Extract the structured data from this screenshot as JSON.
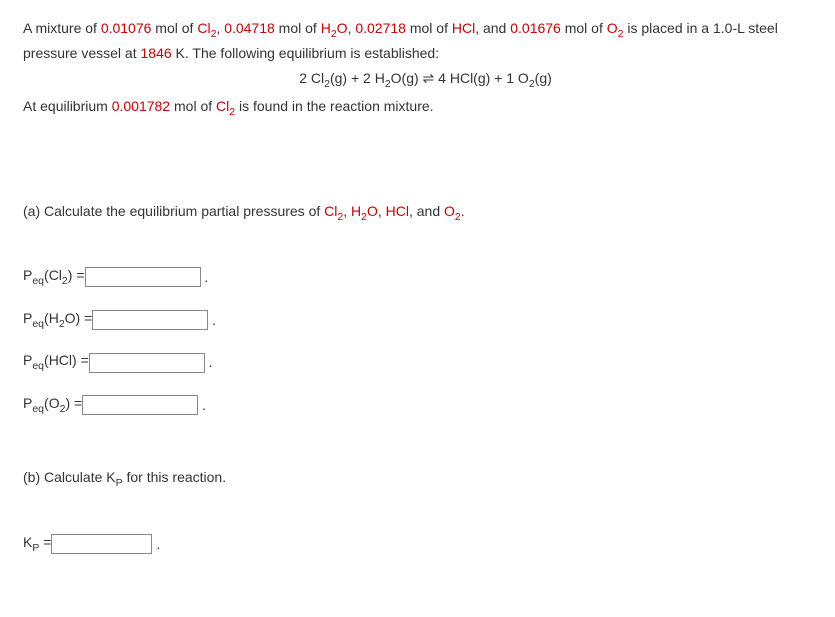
{
  "problem": {
    "intro1": "A mixture of ",
    "val1": "0.01076",
    "unit1": " mol of ",
    "sp1": "Cl",
    "sp1sub": "2",
    "sep1": ", ",
    "val2": "0.04718",
    "unit2": " mol of ",
    "sp2": "H",
    "sp2sub": "2",
    "sp2b": "O",
    "sep2": ", ",
    "val3": "0.02718",
    "unit3": " mol of ",
    "sp3": "HCl",
    "sep3": ", and ",
    "val4": "0.01676",
    "unit4": " mol of ",
    "sp4": "O",
    "sp4sub": "2",
    "tail1": " is placed in a 1.0-L steel",
    "line2a": "pressure vessel at ",
    "temp": "1846",
    "line2b": " K. The following equilibrium is established:",
    "eq_l1": "2 Cl",
    "eq_l1sub": "2",
    "eq_l2": "(g) + 2 H",
    "eq_l2sub": "2",
    "eq_l3": "O(g) ",
    "eq_harpoon": "⇌",
    "eq_r1": " 4 HCl(g) + 1 O",
    "eq_r1sub": "2",
    "eq_r2": "(g)",
    "line3a": "At equilibrium ",
    "val5": "0.001782",
    "line3b": " mol of ",
    "sp5": "Cl",
    "sp5sub": "2",
    "line3c": " is found in the reaction mixture."
  },
  "partA": {
    "prompt1": "(a) Calculate the equilibrium partial pressures of ",
    "s1": "Cl",
    "s1sub": "2",
    "sep1": ", ",
    "s2": "H",
    "s2sub": "2",
    "s2b": "O",
    "sep2": ", ",
    "s3": "HCl",
    "sep3": ", and ",
    "s4": "O",
    "s4sub": "2",
    "tail": "."
  },
  "labels": {
    "peq": "P",
    "peqsub": "eq",
    "cl2a": "(Cl",
    "cl2sub": "2",
    "cl2b": ") = ",
    "h2oa": "(H",
    "h2osub": "2",
    "h2ob": "O) = ",
    "hcla": "(HCl) = ",
    "o2a": "(O",
    "o2sub": "2",
    "o2b": ") = ",
    "period": "."
  },
  "partB": {
    "prompt1": "(b) Calculate K",
    "psub": "P",
    "prompt2": " for this reaction.",
    "kp": "K",
    "kpsub": "P",
    "eq": " = "
  }
}
